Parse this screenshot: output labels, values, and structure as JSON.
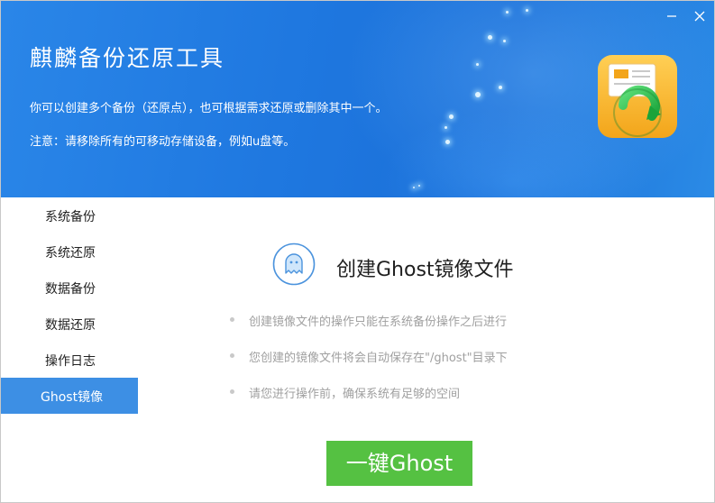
{
  "window": {
    "title": "麒麟备份还原工具",
    "description": "你可以创建多个备份（还原点），也可根据需求还原或删除其中一个。",
    "notice": "注意：请移除所有的可移动存储设备，例如u盘等。"
  },
  "controls": {
    "minimize_icon": "minimize-icon",
    "close_icon": "close-icon"
  },
  "sidebar": {
    "items": [
      {
        "label": "系统备份",
        "active": false
      },
      {
        "label": "系统还原",
        "active": false
      },
      {
        "label": "数据备份",
        "active": false
      },
      {
        "label": "数据还原",
        "active": false
      },
      {
        "label": "操作日志",
        "active": false
      },
      {
        "label": "Ghost镜像",
        "active": true
      }
    ]
  },
  "main": {
    "feature_icon": "ghost-icon",
    "title": "创建Ghost镜像文件",
    "tips": [
      "创建镜像文件的操作只能在系统备份操作之后进行",
      "您创建的镜像文件将会自动保存在\"/ghost\"目录下",
      "请您进行操作前，确保系统有足够的空间"
    ],
    "action_label": "一键Ghost"
  },
  "colors": {
    "header_blue": "#1f78e0",
    "active_nav": "#3d8fe4",
    "action_green": "#55c142",
    "tip_text": "#a0a0a0"
  }
}
